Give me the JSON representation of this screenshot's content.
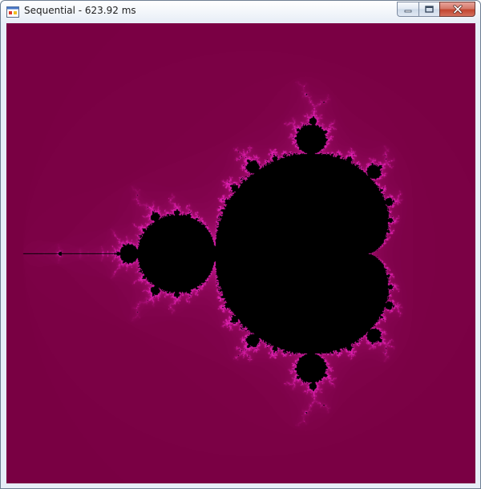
{
  "window": {
    "title": "Sequential - 623.92 ms",
    "icons": {
      "app": "app-window-icon",
      "minimize": "minimize-icon",
      "maximize": "maximize-icon",
      "close": "close-icon"
    }
  },
  "canvas": {
    "content": "mandelbrot-fractal",
    "colors": {
      "background": "#800047",
      "set": "#000000",
      "edge": "#e020b0"
    }
  }
}
